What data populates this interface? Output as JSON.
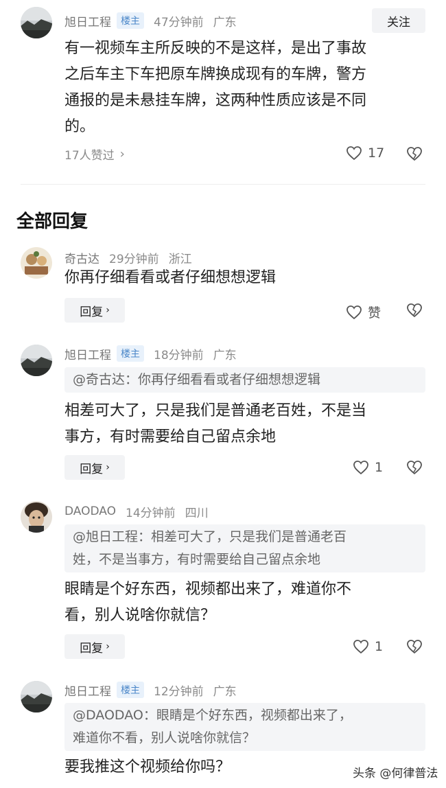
{
  "main_comment": {
    "user": "旭日工程",
    "badge": "楼主",
    "time": "47分钟前",
    "location": "广东",
    "follow_label": "关注",
    "lines": [
      "有一视频车主所反映的不是这样，是出了事故",
      "之后车主下车把原车牌换成现有的车牌，警方",
      "通报的是未悬挂车牌，这两种性质应该是不同",
      "的。"
    ],
    "likers_text": "17人赞过",
    "like_count": "17"
  },
  "section_title": "全部回复",
  "replies": [
    {
      "user": "奇古达",
      "time": "29分钟前",
      "location": "浙江",
      "lines": [
        "你再仔细看看或者仔细想想逻辑"
      ],
      "reply_label": "回复",
      "like_count": "赞"
    },
    {
      "user": "旭日工程",
      "badge": "楼主",
      "time": "18分钟前",
      "location": "广东",
      "quote": [
        "@奇古达：你再仔细看看或者仔细想想逻辑"
      ],
      "lines": [
        "相差可大了，只是我们是普通老百姓，不是当",
        "事方，有时需要给自己留点余地"
      ],
      "reply_label": "回复",
      "like_count": "1"
    },
    {
      "user": "DAODAO",
      "time": "14分钟前",
      "location": "四川",
      "quote": [
        "@旭日工程：相差可大了，只是我们是普通老百",
        "姓，不是当事方，有时需要给自己留点余地"
      ],
      "lines": [
        "眼睛是个好东西，视频都出来了，难道你不",
        "看，别人说啥你就信？"
      ],
      "reply_label": "回复",
      "like_count": "1"
    },
    {
      "user": "旭日工程",
      "badge": "楼主",
      "time": "12分钟前",
      "location": "广东",
      "quote": [
        "@DAODAO：眼睛是个好东西，视频都出来了，",
        "难道你不看，别人说啥你就信？"
      ],
      "lines": [
        "要我推这个视频给你吗？"
      ]
    }
  ],
  "watermark": "头条 @何律普法",
  "colors": {
    "badge_bg": "#e8f1fb",
    "badge_text": "#4a86c8",
    "button_bg": "#f2f3f5",
    "quote_bg": "#f4f5f7"
  },
  "icons": {
    "like": "heart-outline-icon",
    "dislike": "broken-heart-icon",
    "more": "chevron-right-icon"
  }
}
